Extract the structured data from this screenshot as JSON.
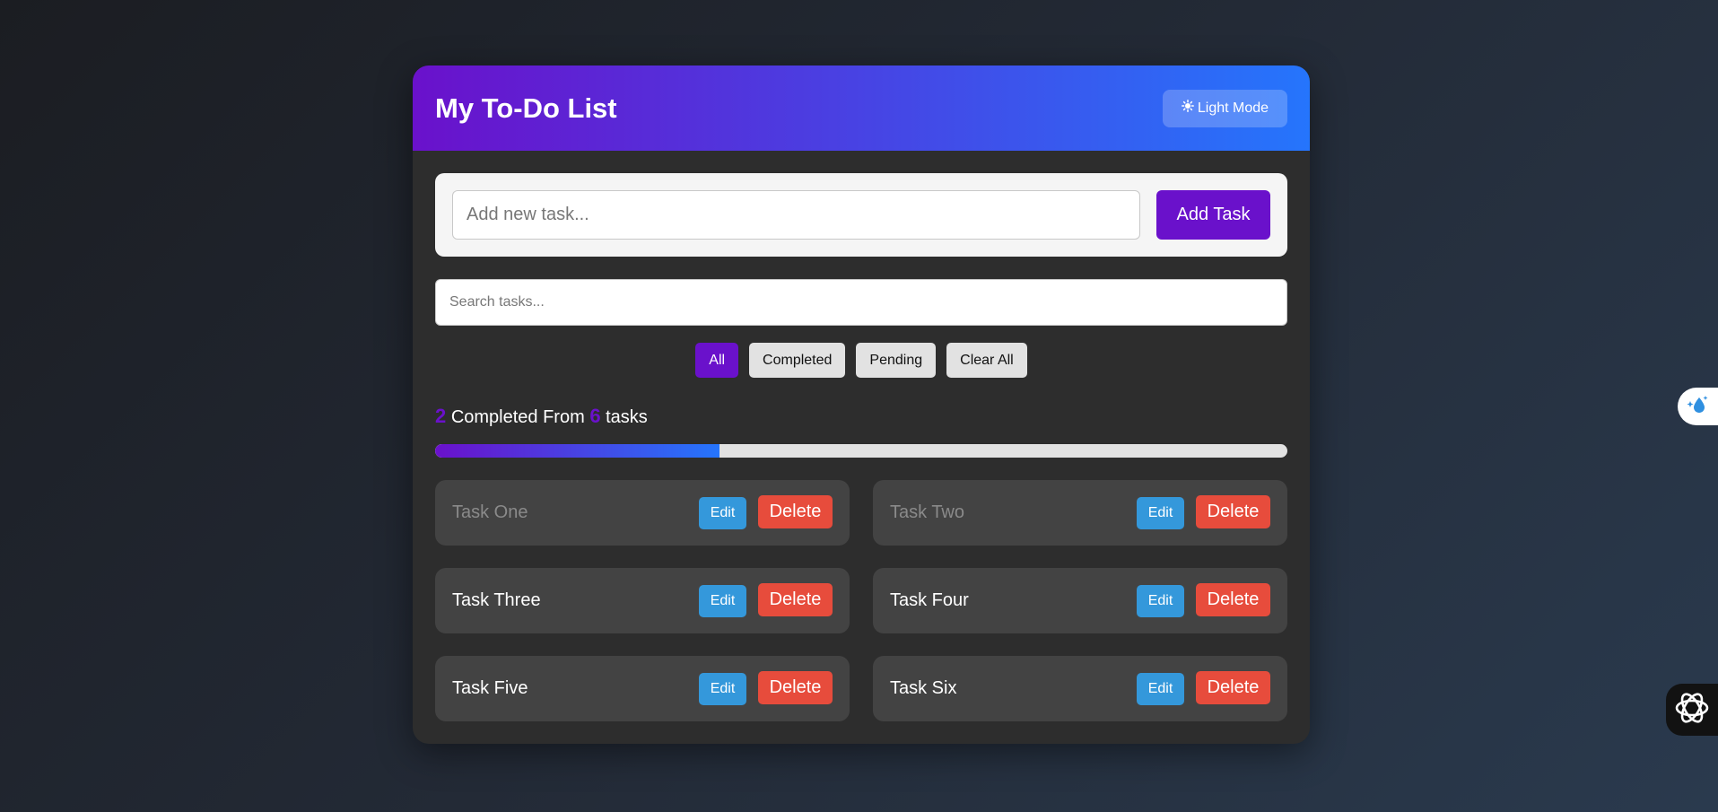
{
  "header": {
    "title": "My To-Do List",
    "mode_button_icon": "sun-icon",
    "mode_button_label": "Light Mode"
  },
  "add_task": {
    "placeholder": "Add new task...",
    "value": "",
    "button_label": "Add Task"
  },
  "search": {
    "placeholder": "Search tasks...",
    "value": ""
  },
  "filters": [
    {
      "label": "All",
      "active": true
    },
    {
      "label": "Completed",
      "active": false
    },
    {
      "label": "Pending",
      "active": false
    },
    {
      "label": "Clear All",
      "active": false
    }
  ],
  "stats": {
    "completed": "2",
    "between_text": "Completed From",
    "total": "6",
    "suffix": "tasks",
    "progress_fraction": 0.3333
  },
  "tasks": [
    {
      "name": "Task One",
      "completed": true,
      "edit_label": "Edit",
      "delete_label": "Delete"
    },
    {
      "name": "Task Two",
      "completed": true,
      "edit_label": "Edit",
      "delete_label": "Delete"
    },
    {
      "name": "Task Three",
      "completed": false,
      "edit_label": "Edit",
      "delete_label": "Delete"
    },
    {
      "name": "Task Four",
      "completed": false,
      "edit_label": "Edit",
      "delete_label": "Delete"
    },
    {
      "name": "Task Five",
      "completed": false,
      "edit_label": "Edit",
      "delete_label": "Delete"
    },
    {
      "name": "Task Six",
      "completed": false,
      "edit_label": "Edit",
      "delete_label": "Delete"
    }
  ],
  "overlays": {
    "extension_icon": "water-drop-sparkle-icon",
    "assistant_icon": "ai-assistant-icon"
  },
  "colors": {
    "accent_purple": "#6a11cb",
    "accent_blue": "#2575fc",
    "edit_blue": "#3498db",
    "delete_red": "#e74c3c",
    "card_bg": "#2d2d2d",
    "task_bg": "#434343"
  }
}
